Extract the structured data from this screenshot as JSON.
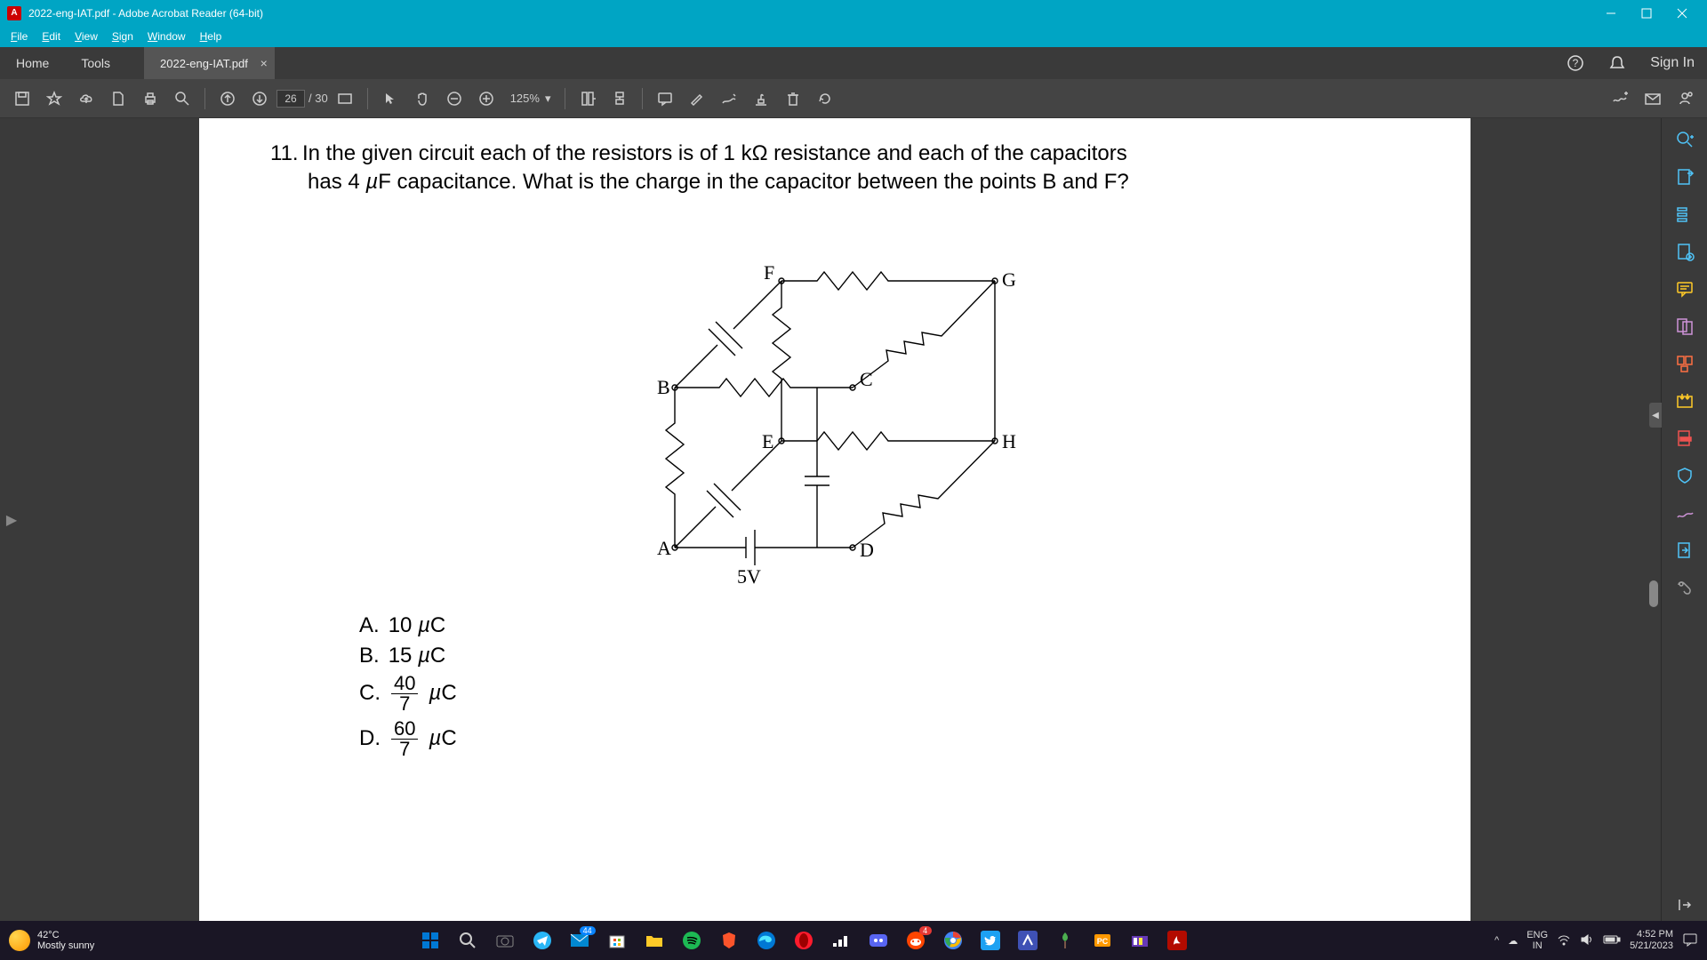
{
  "window": {
    "title": "2022-eng-IAT.pdf - Adobe Acrobat Reader (64-bit)"
  },
  "menu": [
    "File",
    "Edit",
    "View",
    "Sign",
    "Window",
    "Help"
  ],
  "tabs": {
    "home": "Home",
    "tools": "Tools",
    "file": "2022-eng-IAT.pdf",
    "signin": "Sign In"
  },
  "toolbar": {
    "page_current": "26",
    "page_total": "/ 30",
    "zoom": "125%"
  },
  "document": {
    "question_num": "11.",
    "question_text": "In the given circuit each of the resistors is of 1 kΩ resistance and each of the capacitors has 4 µF capacitance. What is the charge in the capacitor between the points B and F?",
    "labels": {
      "A": "A",
      "B": "B",
      "C": "C",
      "D": "D",
      "E": "E",
      "F": "F",
      "G": "G",
      "H": "H",
      "voltage": "5V"
    },
    "options": {
      "A": {
        "letter": "A.",
        "val": "10 µC"
      },
      "B": {
        "letter": "B.",
        "val": "15 µC"
      },
      "C": {
        "letter": "C.",
        "top": "40",
        "bot": "7",
        "unit": "µC"
      },
      "D": {
        "letter": "D.",
        "top": "60",
        "bot": "7",
        "unit": "µC"
      }
    }
  },
  "taskbar": {
    "temp": "42°C",
    "cond": "Mostly sunny",
    "lang1": "ENG",
    "lang2": "IN",
    "time": "4:52 PM",
    "date": "5/21/2023",
    "badge1": "44",
    "badge2": "4"
  }
}
